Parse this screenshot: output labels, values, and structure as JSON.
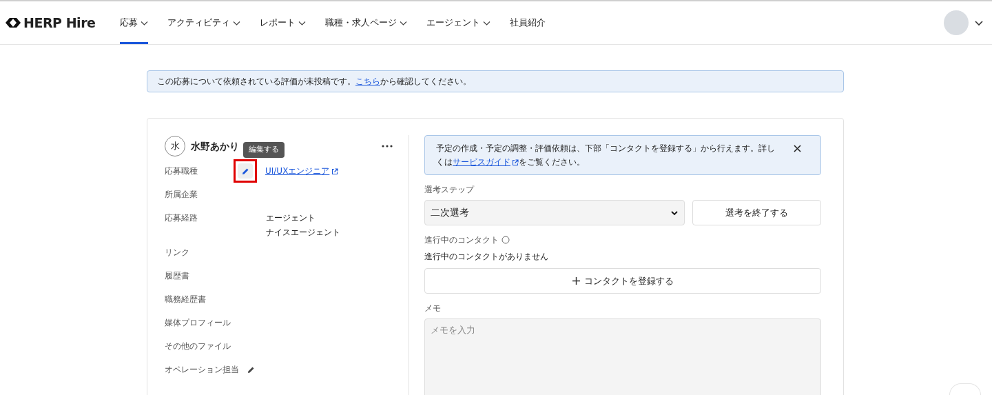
{
  "header": {
    "logo": "HERP Hire",
    "nav": [
      {
        "label": "応募",
        "selected": true,
        "dropdown": true
      },
      {
        "label": "アクティビティ",
        "selected": false,
        "dropdown": true
      },
      {
        "label": "レポート",
        "selected": false,
        "dropdown": true
      },
      {
        "label": "職種・求人ページ",
        "selected": false,
        "dropdown": true
      },
      {
        "label": "エージェント",
        "selected": false,
        "dropdown": true
      },
      {
        "label": "社員紹介",
        "selected": false,
        "dropdown": false
      }
    ]
  },
  "notice": {
    "text_before": "この応募について依頼されている評価が未投稿です。",
    "link": "こちら",
    "text_after": "から確認してください。"
  },
  "candidate": {
    "initial": "水",
    "name": "水野あかり",
    "tooltip": "編集する",
    "fields": [
      {
        "label": "応募職種",
        "kind": "job",
        "values": [
          "UI/UXエンジニア"
        ]
      },
      {
        "label": "所属企業",
        "kind": "plain"
      },
      {
        "label": "応募経路",
        "kind": "plain",
        "values": [
          "エージェント",
          "ナイスエージェント"
        ]
      },
      {
        "label": "リンク",
        "kind": "plain"
      },
      {
        "label": "履歴書",
        "kind": "plain"
      },
      {
        "label": "職務経歴書",
        "kind": "plain"
      },
      {
        "label": "媒体プロフィール",
        "kind": "plain"
      },
      {
        "label": "その他のファイル",
        "kind": "plain"
      },
      {
        "label": "オペレーション担当",
        "kind": "editable"
      }
    ]
  },
  "info": {
    "text_before": "予定の作成・予定の調整・評価依頼は、下部「コンタクトを登録する」から行えます。詳しくは",
    "link": "サービスガイド",
    "text_after": "をご覧ください。"
  },
  "step": {
    "label": "選考ステップ",
    "value": "二次選考",
    "button": "選考を終了する"
  },
  "contacts": {
    "label": "進行中のコンタクト",
    "empty": "進行中のコンタクトがありません",
    "button": "コンタクトを登録する"
  },
  "memo": {
    "label": "メモ",
    "placeholder": "メモを入力"
  }
}
